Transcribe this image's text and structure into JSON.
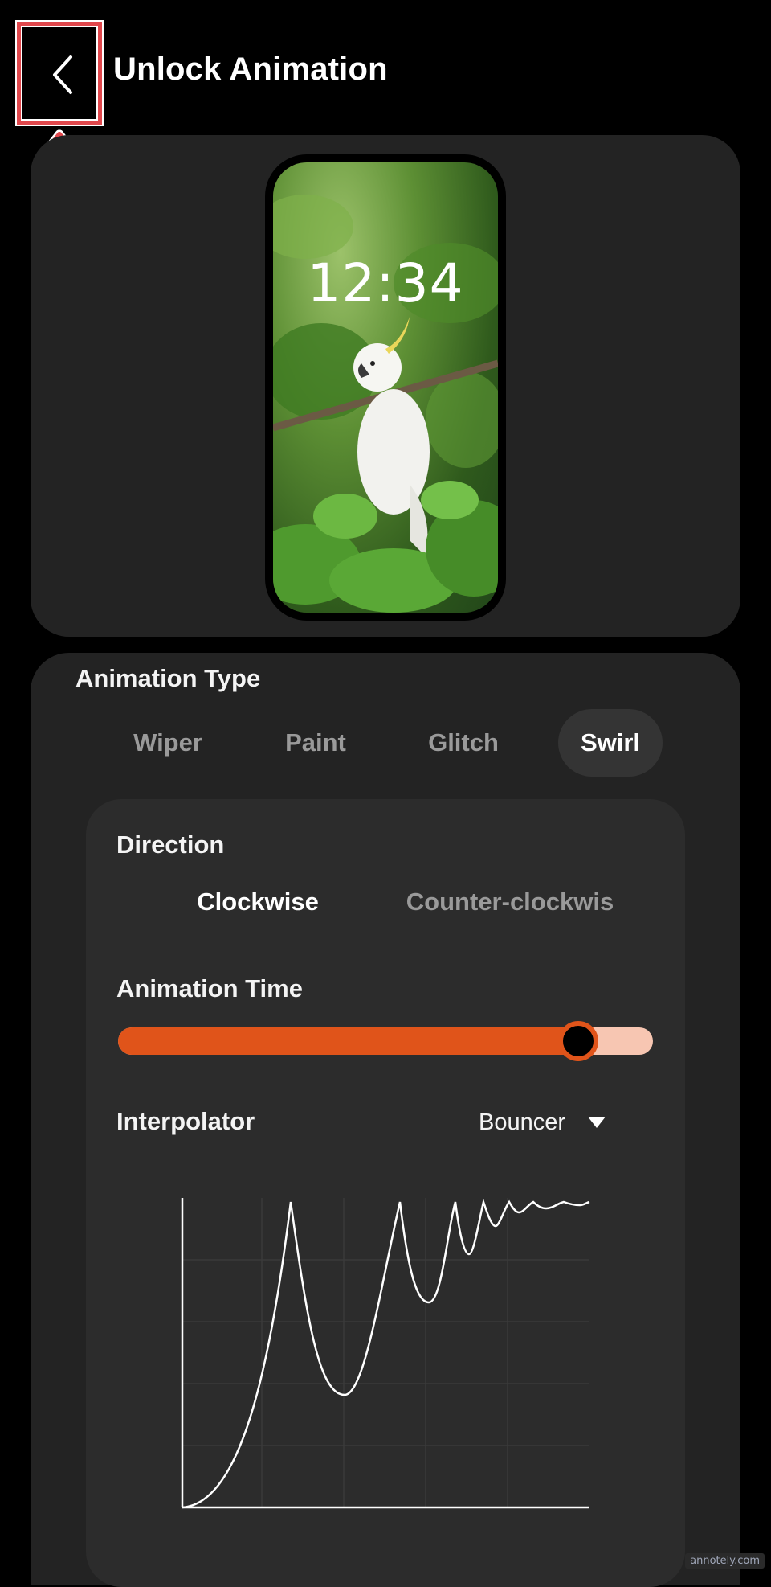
{
  "header": {
    "title": "Unlock Animation",
    "back_icon": "chevron-left-icon"
  },
  "preview": {
    "time": "12:34",
    "wallpaper": "white cockatoo on branch among green leaves"
  },
  "animation_type": {
    "label": "Animation Type",
    "tabs": [
      {
        "label": "Wiper",
        "active": false
      },
      {
        "label": "Paint",
        "active": false
      },
      {
        "label": "Glitch",
        "active": false
      },
      {
        "label": "Swirl",
        "active": true
      }
    ]
  },
  "direction": {
    "label": "Direction",
    "options": [
      {
        "label": "Clockwise",
        "selected": true
      },
      {
        "label": "Counter-clockwis",
        "selected": false
      }
    ]
  },
  "animation_time": {
    "label": "Animation Time",
    "value_fraction": 0.86
  },
  "interpolator": {
    "label": "Interpolator",
    "value": "Bouncer"
  },
  "watermark": "annotely.com",
  "colors": {
    "accent": "#e0541a",
    "accent_light": "#f7c6b2",
    "annotation": "#e0474c"
  }
}
